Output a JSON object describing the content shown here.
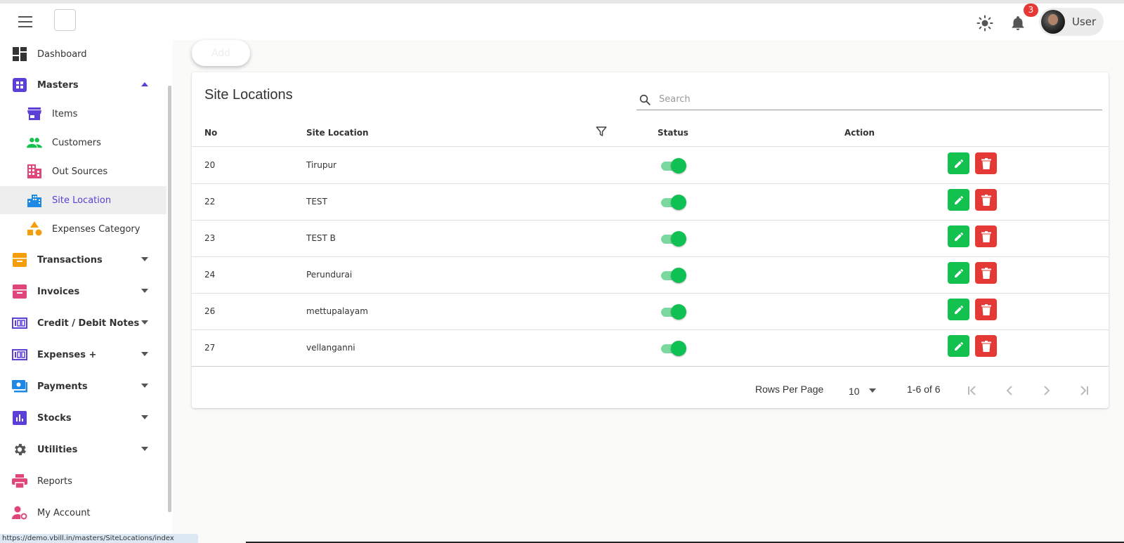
{
  "header": {
    "user_label": "User",
    "notification_count": "3"
  },
  "sidebar": {
    "items": [
      {
        "label": "Dashboard",
        "icon": "dashboard-icon",
        "color": "#333333"
      },
      {
        "label": "Masters",
        "icon": "grid-icon",
        "color": "#5b3fd6"
      },
      {
        "label": "Items",
        "icon": "store-icon",
        "color": "#5b3fd6"
      },
      {
        "label": "Customers",
        "icon": "people-icon",
        "color": "#13c14f"
      },
      {
        "label": "Out Sources",
        "icon": "building-icon",
        "color": "#e0457b"
      },
      {
        "label": "Site Location",
        "icon": "city-icon",
        "color": "#1e88e5"
      },
      {
        "label": "Expenses Category",
        "icon": "shapes-icon",
        "color": "#f59e0b"
      },
      {
        "label": "Transactions",
        "icon": "inbox-icon",
        "color": "#f59e0b"
      },
      {
        "label": "Invoices",
        "icon": "archive-icon",
        "color": "#e0457b"
      },
      {
        "label": "Credit / Debit Notes",
        "icon": "counter-icon",
        "color": "#5b3fd6"
      },
      {
        "label": "Expenses +",
        "icon": "counter-icon",
        "color": "#5b3fd6"
      },
      {
        "label": "Payments",
        "icon": "payment-icon",
        "color": "#1e88e5"
      },
      {
        "label": "Stocks",
        "icon": "bar-chart-icon",
        "color": "#5b3fd6"
      },
      {
        "label": "Utilities",
        "icon": "gear-icon",
        "color": "#555555"
      },
      {
        "label": "Reports",
        "icon": "printer-icon",
        "color": "#e0457b"
      },
      {
        "label": "My Account",
        "icon": "user-settings-icon",
        "color": "#e0457b"
      }
    ]
  },
  "status_url": "https://demo.vbill.in/masters/SiteLocations/index",
  "main": {
    "add_label": "Add",
    "title": "Site Locations",
    "search_placeholder": "Search",
    "columns": {
      "no": "No",
      "site_location": "Site Location",
      "status": "Status",
      "action": "Action"
    },
    "rows": [
      {
        "no": "20",
        "site_location": "Tirupur",
        "status": true
      },
      {
        "no": "22",
        "site_location": "TEST",
        "status": true
      },
      {
        "no": "23",
        "site_location": "TEST B",
        "status": true
      },
      {
        "no": "24",
        "site_location": "Perundurai",
        "status": true
      },
      {
        "no": "26",
        "site_location": "mettupalayam",
        "status": true
      },
      {
        "no": "27",
        "site_location": "vellanganni",
        "status": true
      }
    ],
    "footer": {
      "rows_per_page_label": "Rows Per Page",
      "rows_per_page_value": "10",
      "range": "1-6 of 6"
    }
  },
  "colors": {
    "accent": "#5b3fd6",
    "edit_button": "#13c14f",
    "delete_button": "#e53935",
    "toggle_on": "#0fc152"
  }
}
